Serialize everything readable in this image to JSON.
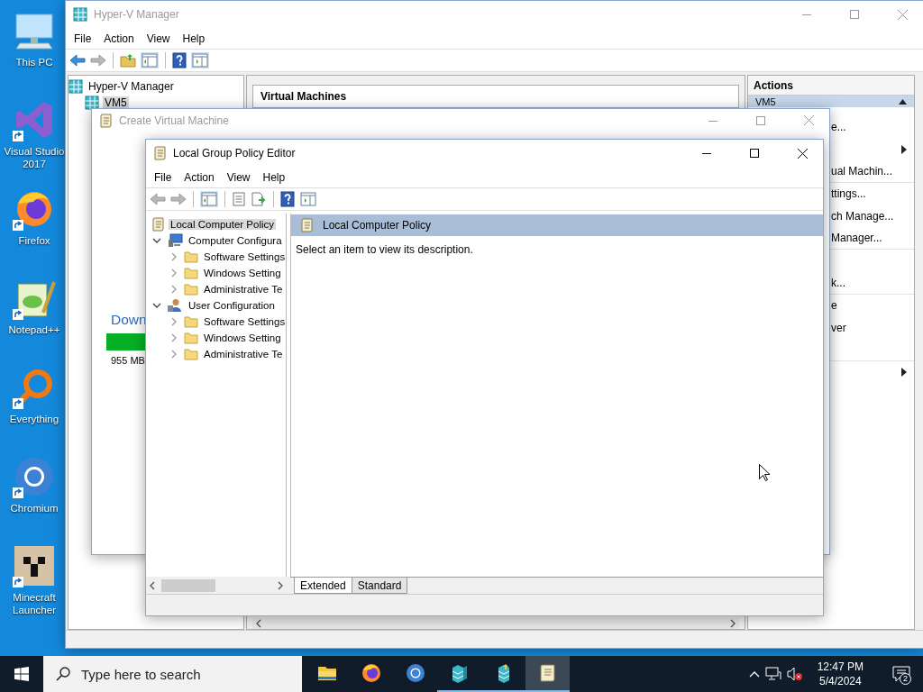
{
  "desktop_icons": [
    {
      "label": "This PC",
      "kind": "pc",
      "shortcut": false
    },
    {
      "label": "Visual Studio 2017",
      "kind": "vs",
      "shortcut": true
    },
    {
      "label": "Firefox",
      "kind": "firefox",
      "shortcut": true
    },
    {
      "label": "Notepad++",
      "kind": "notepad",
      "shortcut": true
    },
    {
      "label": "Everything",
      "kind": "everything",
      "shortcut": true
    },
    {
      "label": "Chromium",
      "kind": "chromium",
      "shortcut": true
    },
    {
      "label": "Minecraft Launcher",
      "kind": "block",
      "shortcut": true
    }
  ],
  "hyperv_window": {
    "title": "Hyper-V Manager",
    "active": false,
    "menu": [
      "File",
      "Action",
      "View",
      "Help"
    ],
    "tree": [
      {
        "label": "Hyper-V Manager",
        "kind": "manager",
        "selected": false,
        "children": [
          {
            "label": "VM5",
            "kind": "server",
            "selected": true
          }
        ]
      }
    ],
    "center_header": "Virtual Machines",
    "actions": {
      "header": "Actions",
      "group": "VM5",
      "expanded": true,
      "groups": [
        [
          {
            "kind": "item",
            "label": "e..."
          },
          {
            "kind": "submenu"
          },
          {
            "kind": "item",
            "label": "ual Machin..."
          }
        ],
        [
          {
            "kind": "item",
            "label": "ttings..."
          },
          {
            "kind": "item",
            "label": "ch Manage..."
          },
          {
            "kind": "item",
            "label": "Manager..."
          }
        ],
        [
          {
            "kind": "blank"
          },
          {
            "kind": "item",
            "label": "k..."
          }
        ],
        [
          {
            "kind": "item",
            "label": "e"
          },
          {
            "kind": "item",
            "label": "ver"
          },
          {
            "kind": "blank"
          }
        ],
        [
          {
            "kind": "submenu"
          }
        ]
      ]
    }
  },
  "create_vm_window": {
    "title": "Create Virtual Machine",
    "active": false,
    "heading": "Down",
    "progress": {
      "level": 1
    },
    "size": "955 MB"
  },
  "gpe_window": {
    "title": "Local Group Policy Editor",
    "active": true,
    "menu": [
      "File",
      "Action",
      "View",
      "Help"
    ],
    "tree": [
      {
        "label": "Local Computer Policy",
        "kind": "policy",
        "selected": true,
        "children": [
          {
            "label": "Computer Configura",
            "kind": "computer",
            "selected": false,
            "expanded": true,
            "children": [
              {
                "label": "Software Settings",
                "kind": "folder",
                "selected": false,
                "expanded": false
              },
              {
                "label": "Windows Setting",
                "kind": "folder",
                "selected": false,
                "expanded": false
              },
              {
                "label": "Administrative Te",
                "kind": "folder",
                "selected": false,
                "expanded": false
              }
            ]
          },
          {
            "label": "User Configuration",
            "kind": "user",
            "selected": false,
            "expanded": true,
            "children": [
              {
                "label": "Software Settings",
                "kind": "folder",
                "selected": false,
                "expanded": false
              },
              {
                "label": "Windows Setting",
                "kind": "folder",
                "selected": false,
                "expanded": false
              },
              {
                "label": "Administrative Te",
                "kind": "folder",
                "selected": false,
                "expanded": false
              }
            ]
          }
        ]
      }
    ],
    "detail_header": "Local Computer Policy",
    "description": "Select an item to view its description.",
    "tabs": [
      {
        "label": "Extended",
        "selected": true
      },
      {
        "label": "Standard",
        "selected": false
      }
    ]
  },
  "taskbar": {
    "search": {
      "placeholder": "Type here to search"
    },
    "apps": [
      {
        "kind": "explorer",
        "running": false,
        "selected": false
      },
      {
        "kind": "firefox",
        "running": false,
        "selected": false
      },
      {
        "kind": "chromium",
        "running": false,
        "selected": false
      },
      {
        "kind": "hyperv",
        "running": true,
        "selected": false
      },
      {
        "kind": "createvm",
        "running": true,
        "selected": false
      },
      {
        "kind": "policy",
        "running": true,
        "selected": true
      }
    ],
    "time": "12:47 PM",
    "date": "5/4/2024",
    "notification_count": "2"
  }
}
